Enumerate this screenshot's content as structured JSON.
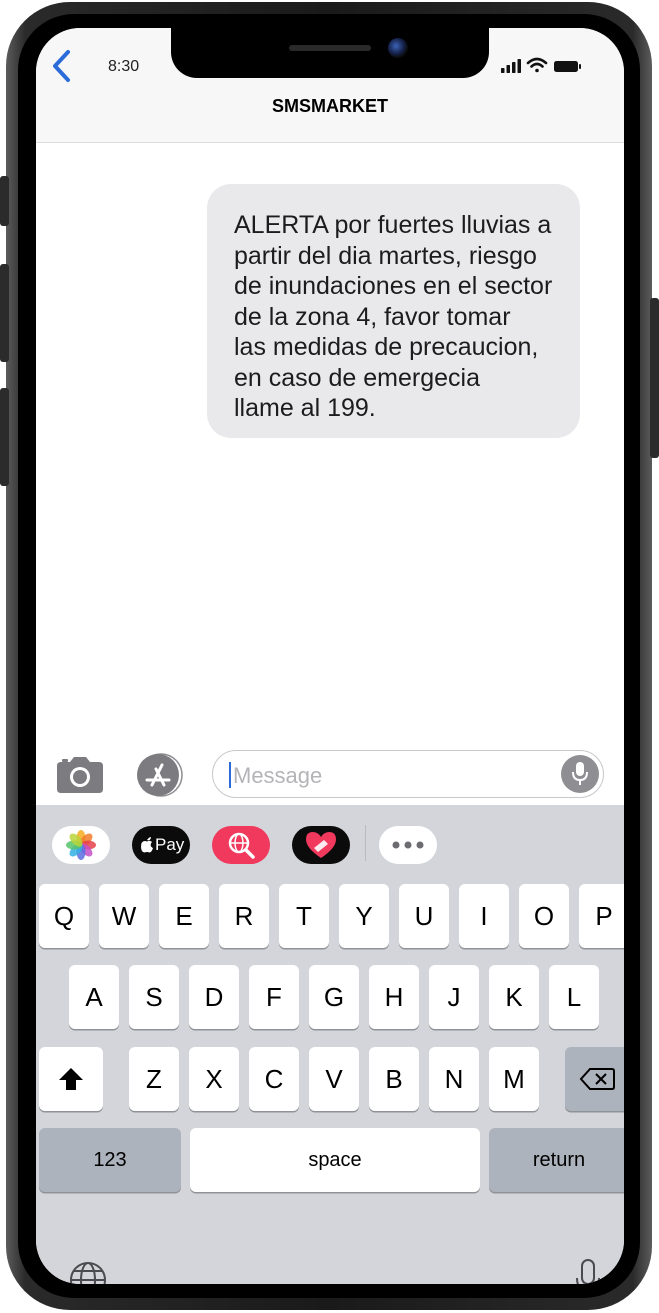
{
  "status_bar": {
    "time": "8:30"
  },
  "header": {
    "contact_name": "SMSMARKET"
  },
  "message": {
    "text": "ALERTA por fuertes lluvias a\npartir del dia martes, riesgo\nde inundaciones en el sector\nde la zona 4, favor tomar\nlas medidas de precaucion,\nen caso de emergecia\nllame al 199."
  },
  "composer": {
    "placeholder": "Message"
  },
  "app_strip": {
    "apple_pay_label": "Pay"
  },
  "keyboard": {
    "row1": [
      "Q",
      "W",
      "E",
      "R",
      "T",
      "Y",
      "U",
      "I",
      "O",
      "P"
    ],
    "row2": [
      "A",
      "S",
      "D",
      "F",
      "G",
      "H",
      "J",
      "K",
      "L"
    ],
    "row3": [
      "Z",
      "X",
      "C",
      "V",
      "B",
      "N",
      "M"
    ],
    "numbers_label": "123",
    "space_label": "space",
    "return_label": "return"
  },
  "colors": {
    "accent": "#2b6cd9",
    "bubble": "#e9e9eb",
    "keyboard_bg": "#d3d5da"
  }
}
